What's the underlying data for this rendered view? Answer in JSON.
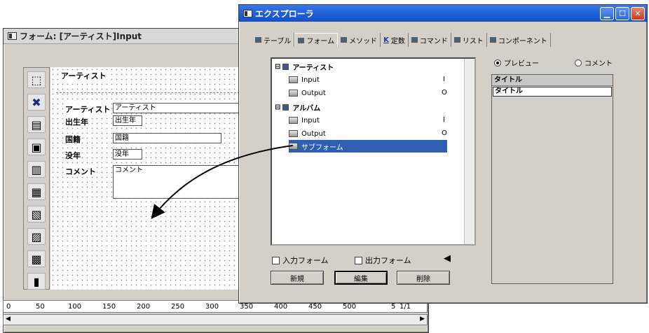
{
  "form_window": {
    "title": "フォーム: [アーティスト]Input",
    "header_label": "アーティスト",
    "fields": [
      {
        "label": "アーティスト",
        "value": "アーティスト"
      },
      {
        "label": "出生年",
        "value": "出生年"
      },
      {
        "label": "国籍",
        "value": "国籍"
      },
      {
        "label": "没年",
        "value": "没年"
      },
      {
        "label": "コメント",
        "value": "コメント"
      }
    ],
    "ruler_marks": [
      "0",
      "50",
      "100",
      "150",
      "200",
      "250",
      "300",
      "350",
      "400",
      "450",
      "500",
      "5"
    ],
    "page_indicator": "1/1"
  },
  "explorer": {
    "title": "エクスプローラ",
    "tabs": [
      {
        "label": "テーブル",
        "icon": "table-icon"
      },
      {
        "label": "フォーム",
        "icon": "form-icon"
      },
      {
        "label": "メソッド",
        "icon": "method-icon"
      },
      {
        "label": "定数",
        "icon": "constant-icon",
        "prefix": "K"
      },
      {
        "label": "コマンド",
        "icon": "command-icon"
      },
      {
        "label": "リスト",
        "icon": "list-icon"
      },
      {
        "label": "コンポーネント",
        "icon": "component-icon"
      }
    ],
    "active_tab": "フォーム",
    "tree": {
      "groups": [
        {
          "name": "アーティスト",
          "items": [
            {
              "name": "Input",
              "type": "I"
            },
            {
              "name": "Output",
              "type": "O"
            }
          ]
        },
        {
          "name": "アルバム",
          "items": [
            {
              "name": "Input",
              "type": "I"
            },
            {
              "name": "Output",
              "type": "O"
            },
            {
              "name": "サブフォーム",
              "type": "",
              "selected": true
            }
          ]
        }
      ]
    },
    "radio": {
      "preview": "プレビュー",
      "comment": "コメント",
      "selected": "preview"
    },
    "preview": {
      "title": "タイトル",
      "field": "タイトル"
    },
    "checkboxes": {
      "input_form": "入力フォーム",
      "output_form": "出力フォーム"
    },
    "buttons": {
      "new": "新規",
      "edit": "編集",
      "delete": "削除"
    }
  },
  "colors": {
    "titlebar_blue": "#1c5cd6",
    "selection": "#2f5fb3",
    "arrow": "#000000"
  }
}
